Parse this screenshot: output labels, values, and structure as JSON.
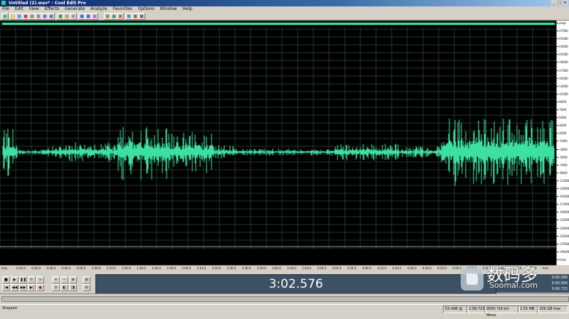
{
  "window": {
    "title": "Untitled (2).wav* - Cool Edit Pro",
    "min_glyph": "_",
    "max_glyph": "□",
    "close_glyph": "×"
  },
  "menu": [
    "File",
    "Edit",
    "View",
    "Effects",
    "Generate",
    "Analyze",
    "Favorites",
    "Options",
    "Window",
    "Help"
  ],
  "toolbar": {
    "button_icons": [
      "wave-view-icon",
      "open-icon",
      "save-icon",
      "cut-icon",
      "copy-icon",
      "paste-icon",
      "undo-icon",
      "redo-icon",
      "mix-icon",
      "trim-icon",
      "silence-icon",
      "zoom-in-icon",
      "zoom-out-icon",
      "cd-icon",
      "multitrack-icon",
      "loop-icon",
      "frequency-icon",
      "spectral-icon",
      "cue-icon",
      "settings-icon"
    ]
  },
  "vertical_ruler": {
    "labels": [
      "smpl",
      "27000",
      "25000",
      "23000",
      "21000",
      "19000",
      "17000",
      "15000",
      "13000",
      "11000",
      "9000",
      "7000",
      "5000",
      "3000",
      "1000",
      "-1000",
      "-3000",
      "-5000",
      "-7000",
      "-9000",
      "-11000",
      "-13000",
      "-15000",
      "-17000",
      "-19000",
      "-21000",
      "-23000",
      "-25000",
      "-27000",
      "-29000",
      "smpl"
    ]
  },
  "time_ruler": {
    "labels": [
      "hms",
      "0:10.0",
      "0:20.0",
      "0:30.0",
      "0:40.0",
      "0:50.0",
      "1:00.0",
      "1:10.0",
      "1:20.0",
      "1:30.0",
      "1:40.0",
      "1:50.0",
      "2:00.0",
      "2:10.0",
      "2:20.0",
      "2:30.0",
      "2:40.0",
      "2:50.0",
      "3:00.0",
      "3:10.0",
      "3:20.0",
      "3:30.0",
      "3:40.0",
      "3:50.0",
      "4:00.0",
      "4:10.0",
      "4:20.0",
      "4:30.0",
      "4:40.0",
      "4:50.0",
      "5:00.0",
      "5:10.0",
      "5:20.0",
      "5:30.0",
      "5:40.0",
      "5:50.0",
      "hms"
    ]
  },
  "transport": {
    "stop": "■",
    "play": "▶",
    "pause": "❚❚",
    "play_loop": "↻",
    "play_all": "∞",
    "go_start": "|◀",
    "rewind": "◀◀",
    "forward": "▶▶",
    "go_end": "▶|",
    "record": "●",
    "zoom_in_h": "+",
    "zoom_out_h": "−",
    "zoom_full": "⊕",
    "zoom_sel": "⊙",
    "zoom_left": "◧",
    "zoom_right": "◨",
    "zoom_in_v": "⊞",
    "zoom_out_v": "⊟"
  },
  "time_display": "3:02.576",
  "status_panel": {
    "begin": "0:00.000",
    "end": "0:00.000",
    "length": "5:56.723"
  },
  "statusbar": {
    "state": "Stopped",
    "level": "53.4dB @",
    "time": "2:58.723",
    "format": "8000 ?16-bit Mono",
    "size": "2.55 MB",
    "free": "25K GB free"
  },
  "watermark": {
    "brand": "数码多",
    "url": "Soomal.com"
  },
  "colors": {
    "waveform": "#3de0a0",
    "background": "#000000",
    "grid": "#1d3a2c",
    "time_display_bg": "#3c5163"
  }
}
